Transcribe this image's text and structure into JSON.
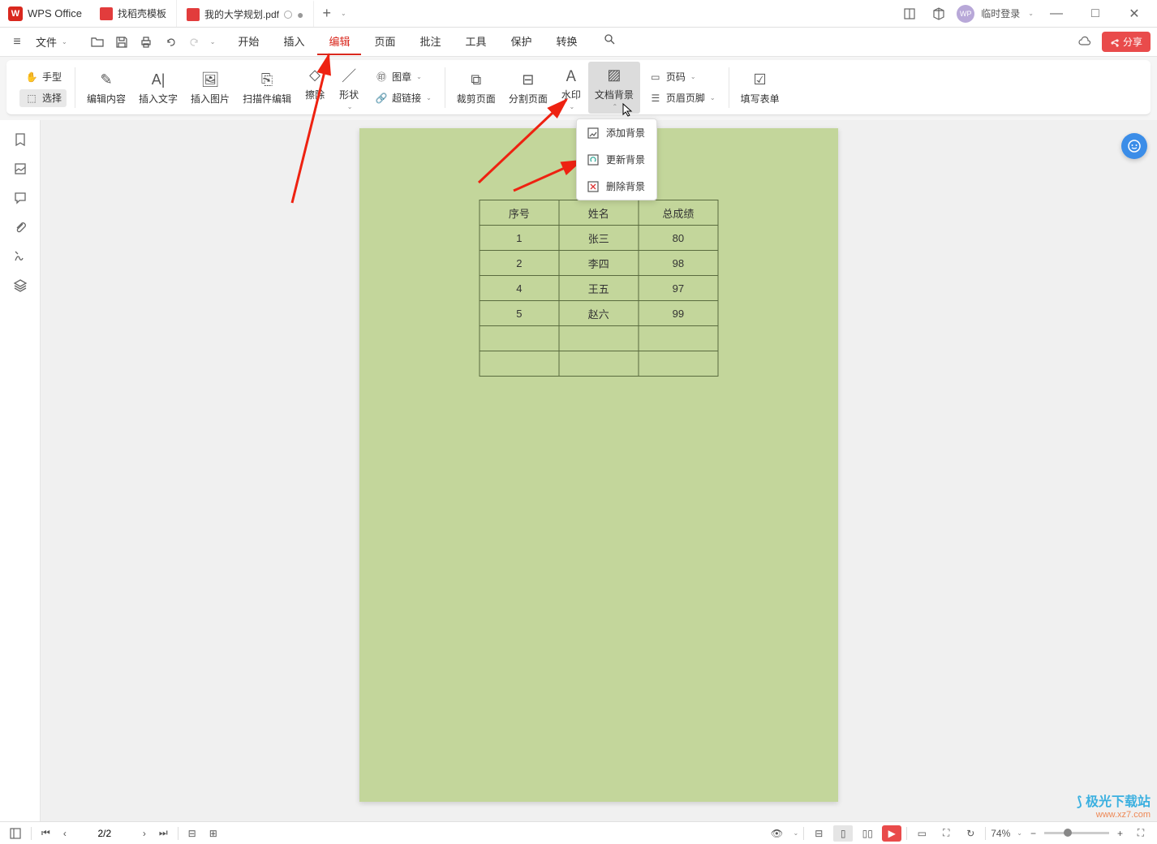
{
  "app": {
    "name": "WPS Office"
  },
  "tabs": [
    {
      "label": "找稻壳模板"
    },
    {
      "label": "我的大学规划.pdf"
    }
  ],
  "title_right": {
    "login": "临时登录"
  },
  "menu": {
    "file": "文件",
    "items": [
      "开始",
      "插入",
      "编辑",
      "页面",
      "批注",
      "工具",
      "保护",
      "转换"
    ],
    "active_index": 2,
    "share": "分享"
  },
  "ribbon": {
    "hand": "手型",
    "select": "选择",
    "edit_content": "编辑内容",
    "insert_text": "插入文字",
    "insert_image": "插入图片",
    "scanner_edit": "扫描件编辑",
    "erase": "擦除",
    "shape": "形状",
    "stamp": "图章",
    "hyperlink": "超链接",
    "crop": "裁剪页面",
    "split": "分割页面",
    "watermark": "水印",
    "background": "文档背景",
    "page_number": "页码",
    "header_footer": "页眉页脚",
    "form_fill": "填写表单"
  },
  "dropdown": {
    "add": "添加背景",
    "update": "更新背景",
    "delete": "删除背景"
  },
  "chart_data": {
    "type": "table",
    "headers": [
      "序号",
      "姓名",
      "总成绩"
    ],
    "rows": [
      [
        "1",
        "张三",
        "80"
      ],
      [
        "2",
        "李四",
        "98"
      ],
      [
        "4",
        "王五",
        "97"
      ],
      [
        "5",
        "赵六",
        "99"
      ],
      [
        "",
        "",
        ""
      ],
      [
        "",
        "",
        ""
      ]
    ]
  },
  "status": {
    "page": "2/2",
    "zoom": "74%"
  },
  "watermark": {
    "site": "极光下载站",
    "url": "www.xz7.com"
  }
}
